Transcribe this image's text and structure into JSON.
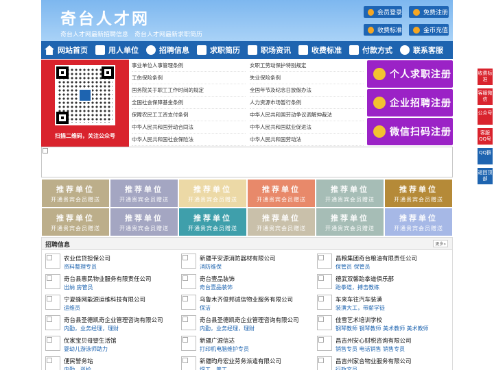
{
  "header": {
    "site_title": "奇台人才网",
    "subtitle": "奇台人才网最新招聘信息　奇台人才网最新求职简历",
    "btn_member_login": "会员登录",
    "btn_free_register": "免费注册",
    "btn_fee_standard": "收费标准",
    "btn_gold_recharge": "金币充值"
  },
  "nav": [
    "网站首页",
    "用人单位",
    "招聘信息",
    "求职简历",
    "职场资讯",
    "收费标准",
    "付款方式",
    "联系客服"
  ],
  "qr": {
    "caption": "扫描二维码，关注公众号"
  },
  "laws_left": [
    "事业单位人事管理条例",
    "工伤保险条例",
    "国务院关于职工工作时间的规定",
    "全国社会保障基金条例",
    "保障农民工工资支付条例",
    "中华人民共和国劳动合同法",
    "中华人民共和国社会保险法"
  ],
  "laws_right": [
    "女职工劳动保护特别规定",
    "失业保险条例",
    "全国年节及纪念日放假办法",
    "人力资源市场暂行条例",
    "中华人民共和国劳动争议调解仲裁法",
    "中华人民共和国就业促进法",
    "中华人民共和国劳动法"
  ],
  "register": {
    "personal": "个人求职注册",
    "company": "企业招聘注册",
    "wechat": "微信扫码注册"
  },
  "promo": {
    "title": "推荐单位",
    "sub": "开通贵宾会员赠送",
    "colors": [
      "#bcae8a",
      "#a4a6c2",
      "#ecd9a6",
      "#e8896a",
      "#a6bdb6",
      "#b58a38",
      "#bcae8a",
      "#a4a6c2",
      "#3f9fab",
      "#c9c0aa",
      "#a6bdb6",
      "#a6b8e6"
    ]
  },
  "jobs": {
    "title": "招聘信息",
    "more": "更多»",
    "companies": [
      {
        "name": "农业信贷担保公司",
        "jobs": "资料整理专员"
      },
      {
        "name": "新疆平安源消防器材有限公司",
        "jobs": "消防维保"
      },
      {
        "name": "昌粮集团奇台粮油有限责任公司",
        "jobs": "保管员  保管员"
      },
      {
        "name": "奇台县惠民物业服务有限责任公司",
        "jobs": "出纳  房管员"
      },
      {
        "name": "奇台壹品装饰",
        "jobs": "奇台壹品装饰"
      },
      {
        "name": "德武双馨跆拳道俱乐部",
        "jobs": "跆拳道，搏击教练"
      },
      {
        "name": "宁夏蜂网能源运维科技有限公司",
        "jobs": "运维员"
      },
      {
        "name": "乌鲁木齐俊邦诚信物业服务有限公司",
        "jobs": "保洁"
      },
      {
        "name": "车来车往汽车装潢",
        "jobs": "装潢大工，带薪学徒"
      },
      {
        "name": "奇台县圣德凯奇企业管理咨询有限公司",
        "jobs": "内勤，业务经理，理财"
      },
      {
        "name": "奇台县圣德凯奇企业管理咨询有限公司",
        "jobs": "内勤，业务经理，理财"
      },
      {
        "name": "佳雪艺术培训学校",
        "jobs": "钢琴教师  钢琴教师  美术教师  美术教师"
      },
      {
        "name": "优家宝贝母婴生活馆",
        "jobs": "婴幼儿游泳师助力"
      },
      {
        "name": "新疆广源信达",
        "jobs": "打印机电脑维护专员"
      },
      {
        "name": "昌吉州安心财税咨询有限公司",
        "jobs": "销售专员  电话销售  销售专员"
      },
      {
        "name": "便民警务站",
        "jobs": "内勤，巡检"
      },
      {
        "name": "新疆昀舟宏业劳务派遣有限公司",
        "jobs": "焊工，普工"
      },
      {
        "name": "昌吉州家合物业服务有限公司",
        "jobs": "行政文员"
      }
    ]
  },
  "side": [
    "收费标准",
    "客服微信",
    "公众号",
    "客服QQ号",
    "QQ群",
    "返回顶部"
  ]
}
